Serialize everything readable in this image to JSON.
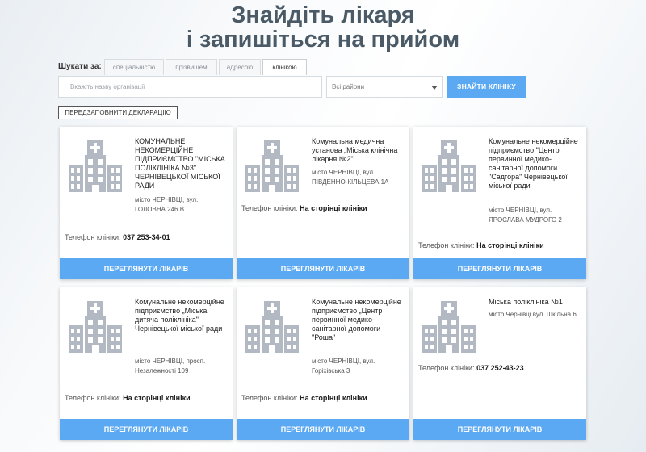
{
  "hero": {
    "line1": "Знайдіть лікаря",
    "line2": "і запишіться на прийом"
  },
  "search": {
    "label": "Шукати за:",
    "tabs": [
      "спеціальністю",
      "прізвищем",
      "адресою",
      "клінікою"
    ],
    "active_tab": "клінікою",
    "org_placeholder": "Вкажіть назву організації",
    "region_value": "Всі райони",
    "find_button": "ЗНАЙТИ КЛІНІКУ",
    "prefill_button": "ПЕРЕДЗАПОВНИТИ ДЕКЛАРАЦІЮ"
  },
  "colors": {
    "accent": "#5ba9f2",
    "title": "#4a5a66"
  },
  "cards": [
    {
      "name": "КОМУНАЛЬНЕ НЕКОМЕРЦІЙНЕ ПІДПРИЄМСТВО \"МІСЬКА ПОЛІКЛІНІКА №3\" ЧЕРНІВЕЦЬКОЇ МІСЬКОЇ РАДИ",
      "address": "місто ЧЕРНІВЦІ, вул. ГОЛОВНА 246 В",
      "phone_label": "Телефон клініки:",
      "phone_value": "037 253-34-01",
      "button": "ПЕРЕГЛЯНУТИ ЛІКАРІВ"
    },
    {
      "name": "Комунальна медична установа „Міська клінічна лікарня №2\"",
      "address": "місто ЧЕРНІВЦІ, вул. ПІВДЕННО-КІЛЬЦЕВА 1А",
      "phone_label": "Телефон клініки:",
      "phone_value": "На сторінці клініки",
      "button": "ПЕРЕГЛЯНУТИ ЛІКАРІВ"
    },
    {
      "name": "Комунальне некомерційне підприємство \"Центр первинної медико-санітарної допомоги \"Садгора\" Чернівецької міської ради",
      "address": "місто ЧЕРНІВЦІ, вул. ЯРОСЛАВА МУДРОГО 2",
      "phone_label": "Телефон клініки:",
      "phone_value": "На сторінці клініки",
      "button": "ПЕРЕГЛЯНУТИ ЛІКАРІВ"
    },
    {
      "name": "Комунальне некомерційне підприємство „Міська дитяча поліклініка\" Чернівецької міської ради",
      "address": "місто ЧЕРНІВЦІ, просп. Незалежності 109",
      "phone_label": "Телефон клініки:",
      "phone_value": "На сторінці клініки",
      "button": "ПЕРЕГЛЯНУТИ ЛІКАРІВ"
    },
    {
      "name": "Комунальне некомерційне підприємство „Центр первинної медико-санітарної допомоги \"Роша\"",
      "address": "місто ЧЕРНІВЦІ, вул. Горіхівська 3",
      "phone_label": "Телефон клініки:",
      "phone_value": "На сторінці клініки",
      "button": "ПЕРЕГЛЯНУТИ ЛІКАРІВ"
    },
    {
      "name": "Міська поліклініка №1",
      "address": "місто Чернівці вул. Шкільна 6",
      "phone_label": "Телефон клініки:",
      "phone_value": "037 252-43-23",
      "button": "ПЕРЕГЛЯНУТИ ЛІКАРІВ"
    }
  ]
}
